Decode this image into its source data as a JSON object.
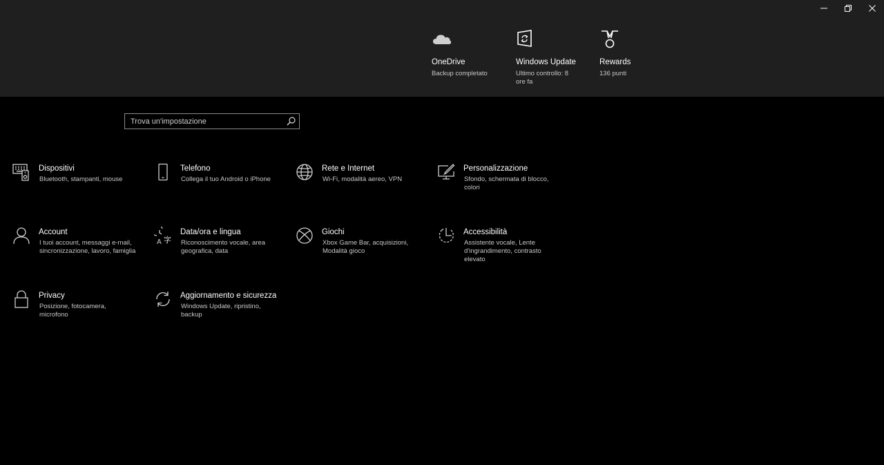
{
  "window": {
    "minimize_icon": "minimize-icon",
    "restore_icon": "restore-icon",
    "close_icon": "close-icon"
  },
  "status": [
    {
      "title": "OneDrive",
      "subtitle": "Backup completato",
      "icon": "cloud-icon"
    },
    {
      "title": "Windows Update",
      "subtitle": "Ultimo controllo: 8 ore fa",
      "icon": "windows-update-icon"
    },
    {
      "title": "Rewards",
      "subtitle": "136 punti",
      "icon": "medal-icon"
    }
  ],
  "search": {
    "placeholder": "Trova un'impostazione",
    "value": "",
    "icon": "search-icon"
  },
  "categories": [
    {
      "title": "Dispositivi",
      "description": "Bluetooth, stampanti, mouse",
      "icon": "devices-icon"
    },
    {
      "title": "Telefono",
      "description": "Collega il tuo Android o iPhone",
      "icon": "phone-icon"
    },
    {
      "title": "Rete e Internet",
      "description": "Wi-Fi, modalità aereo, VPN",
      "icon": "globe-icon"
    },
    {
      "title": "Personalizzazione",
      "description": "Sfondo, schermata di blocco, colori",
      "icon": "personalization-icon"
    },
    {
      "title": "Account",
      "description": "I tuoi account, messaggi e-mail, sincronizzazione, lavoro, famiglia",
      "icon": "person-icon"
    },
    {
      "title": "Data/ora e lingua",
      "description": "Riconoscimento vocale, area geografica, data",
      "icon": "time-language-icon"
    },
    {
      "title": "Giochi",
      "description": "Xbox Game Bar, acquisizioni, Modalità gioco",
      "icon": "xbox-icon"
    },
    {
      "title": "Accessibilità",
      "description": "Assistente vocale, Lente d'ingrandimento, contrasto elevato",
      "icon": "accessibility-icon"
    },
    {
      "title": "Privacy",
      "description": "Posizione, fotocamera, microfono",
      "icon": "lock-icon"
    },
    {
      "title": "Aggiornamento e sicurezza",
      "description": "Windows Update, ripristino, backup",
      "icon": "update-icon"
    }
  ],
  "colors": {
    "background": "#000000",
    "header": "#1f1f1f",
    "text": "#ffffff",
    "secondary_text": "#c8c8c8"
  }
}
